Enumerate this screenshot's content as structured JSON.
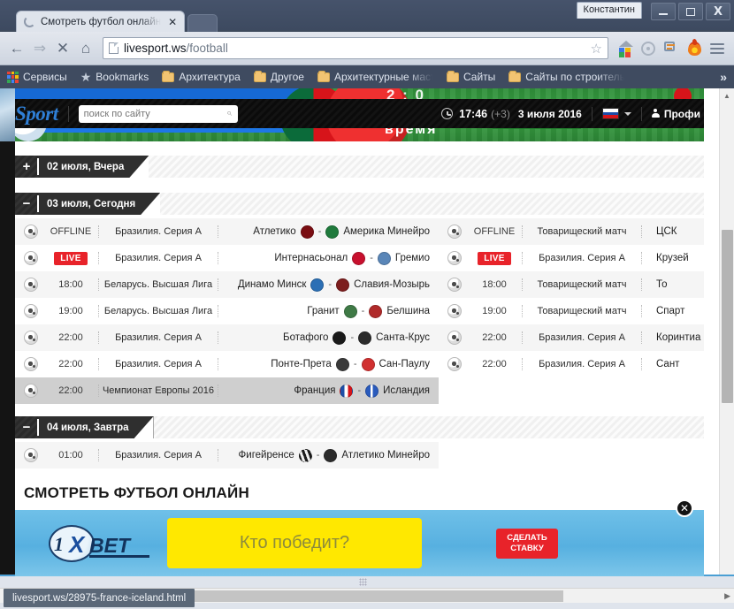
{
  "window": {
    "user_label": "Константин",
    "minimize_icon": "minimize-icon",
    "maximize_icon": "maximize-icon",
    "close_label": "X"
  },
  "tab": {
    "title": "Смотреть футбол онлайн",
    "close_label": "✕",
    "spinner_icon": "loading-spinner-icon",
    "new_tab_label": ""
  },
  "toolbar": {
    "back_label": "←",
    "forward_label": "⇒",
    "stop_label": "✕",
    "home_label": "⌂",
    "url": "livesport.ws",
    "url_path": "/football",
    "star_label": "☆",
    "icons": [
      "home-apps-icon",
      "shield-icon",
      "clipboard-icon",
      "flame-icon",
      "menu-icon"
    ]
  },
  "bookmarks": {
    "items": [
      {
        "label": "Сервисы",
        "icon": "apps-grid-icon"
      },
      {
        "label": "Bookmarks",
        "icon": "star-icon"
      },
      {
        "label": "Архитектура",
        "icon": "folder-icon"
      },
      {
        "label": "Другое",
        "icon": "folder-icon"
      },
      {
        "label": "Архитектурные масте",
        "icon": "folder-icon"
      },
      {
        "label": "Сайты",
        "icon": "folder-icon"
      },
      {
        "label": "Сайты по строительс",
        "icon": "folder-icon"
      }
    ],
    "overflow_label": "»"
  },
  "site_header": {
    "logo": "Sport",
    "search_placeholder": "поиск по сайту",
    "search_value": "",
    "search_icon": "search-icon",
    "clock_icon": "clock-icon",
    "time": "17:46",
    "timezone": "(+3)",
    "date": "3 июля 2016",
    "flag": "ru-flag-icon",
    "profile_label": "Профи",
    "profile_icon": "person-icon"
  },
  "hero": {
    "text_top": "2 : 0",
    "text_bottom": "время"
  },
  "days": [
    {
      "toggle": "+",
      "label": "02 июля, Вчера",
      "expanded": false,
      "left": [],
      "right": []
    },
    {
      "toggle": "−",
      "label": "03 июля, Сегодня",
      "expanded": true,
      "left": [
        {
          "status": "OFFLINE",
          "live": false,
          "league": "Бразилия. Серия А",
          "home": "Атлетико",
          "away": "Америка Минейро",
          "home_color": "#7a0d12",
          "away_color": "#1f7a3c",
          "alt": true,
          "hover": false
        },
        {
          "status": "LIVE",
          "live": true,
          "league": "Бразилия. Серия А",
          "home": "Интернасьонал",
          "away": "Гремио",
          "home_color": "#c8102e",
          "away_color": "#5a86b8",
          "alt": false,
          "hover": false
        },
        {
          "status": "18:00",
          "live": false,
          "league": "Беларусь. Высшая Лига",
          "home": "Динамо Минск",
          "away": "Славия-Мозырь",
          "home_color": "#2b6fb5",
          "away_color": "#7d1d1d",
          "alt": true,
          "hover": false
        },
        {
          "status": "19:00",
          "live": false,
          "league": "Беларусь. Высшая Лига",
          "home": "Гранит",
          "away": "Белшина",
          "home_color": "#3f7a46",
          "away_color": "#b02a2a",
          "alt": false,
          "hover": false
        },
        {
          "status": "22:00",
          "live": false,
          "league": "Бразилия. Серия А",
          "home": "Ботафого",
          "away": "Санта-Крус",
          "home_color": "#1a1a1a",
          "away_color": "#2b2b2b",
          "alt": true,
          "hover": false
        },
        {
          "status": "22:00",
          "live": false,
          "league": "Бразилия. Серия А",
          "home": "Понте-Прета",
          "away": "Сан-Паулу",
          "home_color": "#3a3a3a",
          "away_color": "#d13030",
          "alt": false,
          "hover": false
        },
        {
          "status": "22:00",
          "live": false,
          "league": "Чемпионат Европы 2016",
          "home": "Франция",
          "away": "Исландия",
          "home_color": "#1f4fa8",
          "away_color": "#2a5bbd",
          "alt": false,
          "hover": true
        }
      ],
      "right": [
        {
          "status": "OFFLINE",
          "live": false,
          "league": "Товарищеский матч",
          "home": "ЦСК",
          "away": "",
          "home_color": "#c8102e",
          "away_color": "#2b4f8a",
          "alt": true,
          "hover": false
        },
        {
          "status": "LIVE",
          "live": true,
          "league": "Бразилия. Серия А",
          "home": "Крузей",
          "away": "",
          "home_color": "#1b3f8b",
          "away_color": "#1f7a3c",
          "alt": false,
          "hover": false
        },
        {
          "status": "18:00",
          "live": false,
          "league": "Товарищеский матч",
          "home": "То",
          "away": "",
          "home_color": "#3a6fb0",
          "away_color": "#a02020",
          "alt": true,
          "hover": false
        },
        {
          "status": "19:00",
          "live": false,
          "league": "Товарищеский матч",
          "home": "Спарт",
          "away": "",
          "home_color": "#b4231f",
          "away_color": "#2b2b2b",
          "alt": false,
          "hover": false
        },
        {
          "status": "22:00",
          "live": false,
          "league": "Бразилия. Серия А",
          "home": "Коринтиа",
          "away": "",
          "home_color": "#1a1a1a",
          "away_color": "#8a8a8a",
          "alt": true,
          "hover": false
        },
        {
          "status": "22:00",
          "live": false,
          "league": "Бразилия. Серия А",
          "home": "Сант",
          "away": "",
          "home_color": "#1a1a1a",
          "away_color": "#e0e0e0",
          "alt": false,
          "hover": false
        }
      ]
    },
    {
      "toggle": "−",
      "label": "04 июля, Завтра",
      "expanded": true,
      "left": [
        {
          "status": "01:00",
          "live": false,
          "league": "Бразилия. Серия А",
          "home": "Фигейренсе",
          "away": "Атлетико Минейро",
          "home_color": "#3a3a3a",
          "away_color": "#2b2b2b",
          "alt": true,
          "hover": false
        }
      ],
      "right": []
    }
  ],
  "section_title": "СМОТРЕТЬ ФУТБОЛ ОНЛАЙН",
  "ad": {
    "brand_1x": "1",
    "brand_x": "X",
    "brand_bet": "BET",
    "question": "Кто победит?",
    "cta_line1": "СДЕЛАТЬ",
    "cta_line2": "СТАВКУ",
    "close_label": "✕"
  },
  "status_bar": {
    "link_url": "livesport.ws/28975-france-iceland.html"
  },
  "colors": {
    "accent_blue": "#2f7fd6",
    "live_red": "#e8232a",
    "ad_yellow": "#ffe800",
    "chrome_bg": "#3f4b60"
  }
}
